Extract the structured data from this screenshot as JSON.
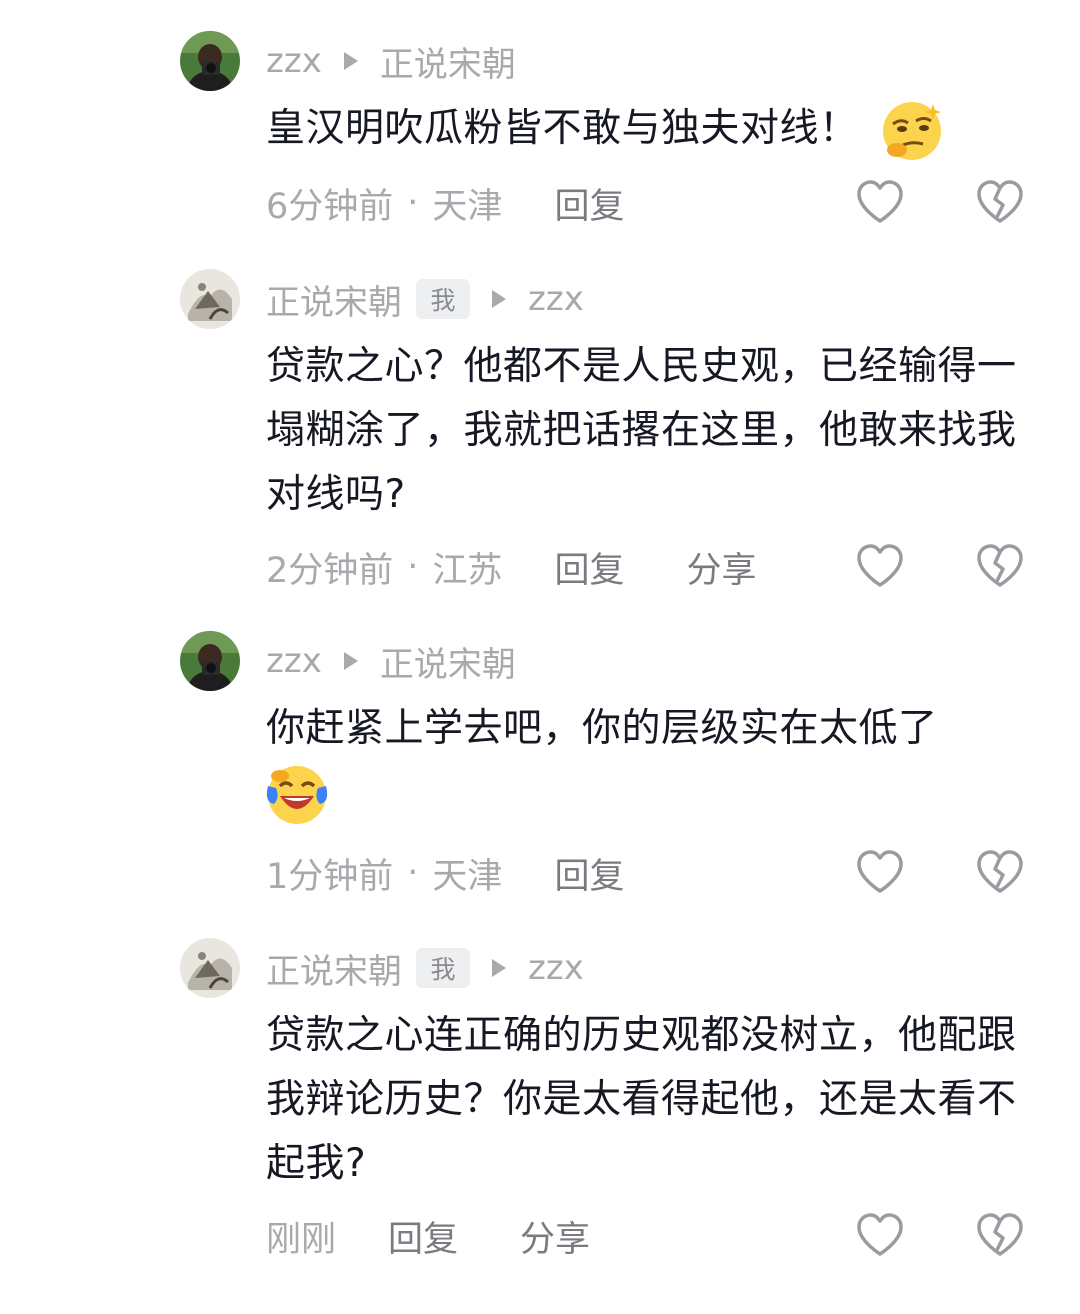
{
  "comments": [
    {
      "author": "zzx",
      "reply_to": "正说宋朝",
      "is_me": false,
      "text": "皇汉明吹瓜粉皆不敢与独夫对线！",
      "emoji": "smirk-emoji",
      "time": "6分钟前",
      "location": "天津",
      "reply_label": "回复",
      "share_label": ""
    },
    {
      "author": "正说宋朝",
      "me_badge": "我",
      "reply_to": "zzx",
      "is_me": true,
      "text": "贷款之心？他都不是人民史观，已经输得一塌糊涂了，我就把话撂在这里，他敢来找我对线吗?",
      "time": "2分钟前",
      "location": "江苏",
      "reply_label": "回复",
      "share_label": "分享"
    },
    {
      "author": "zzx",
      "reply_to": "正说宋朝",
      "is_me": false,
      "text": "你赶紧上学去吧，你的层级实在太低了",
      "emoji": "laugh-cry-emoji",
      "time": "1分钟前",
      "location": "天津",
      "reply_label": "回复",
      "share_label": ""
    },
    {
      "author": "正说宋朝",
      "me_badge": "我",
      "reply_to": "zzx",
      "is_me": true,
      "text": "贷款之心连正确的历史观都没树立，他配跟我辩论历史？你是太看得起他，还是太看不起我?",
      "time": "刚刚",
      "location": "",
      "reply_label": "回复",
      "share_label": "分享"
    }
  ],
  "icons": {
    "like": "heart-outline-icon",
    "dislike": "broken-heart-icon",
    "separator": "triangle-right-icon"
  },
  "colors": {
    "text_primary": "#161823",
    "text_secondary": "#a8a9ad",
    "icon": "#9a9ba0"
  }
}
